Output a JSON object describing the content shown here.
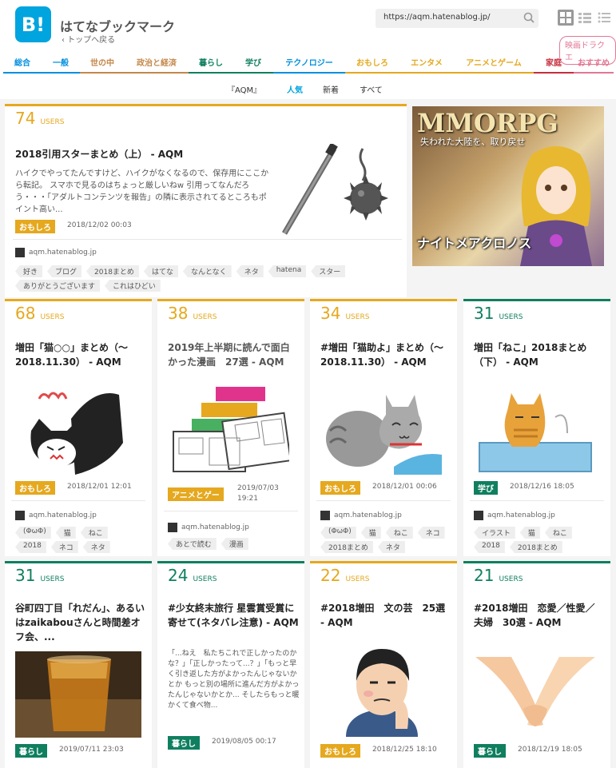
{
  "header": {
    "logo": "B!",
    "title": "はてなブックマーク",
    "back_link": "‹ トップへ戻る",
    "search_value": "https://aqm.hatenablog.jp/",
    "ad_badge": "映画ドラクエ"
  },
  "categories": [
    {
      "label": "総合",
      "color": "#008fde"
    },
    {
      "label": "一般",
      "color": "#008fde"
    },
    {
      "label": "世の中",
      "color": "#c4884a"
    },
    {
      "label": "政治と経済",
      "color": "#c4884a"
    },
    {
      "label": "暮らし",
      "color": "#0f7f5f"
    },
    {
      "label": "学び",
      "color": "#0f7f5f"
    },
    {
      "label": "テクノロジー",
      "color": "#008fde"
    },
    {
      "label": "おもしろ",
      "color": "#e5a81e"
    },
    {
      "label": "エンタメ",
      "color": "#e5a81e"
    },
    {
      "label": "アニメとゲーム",
      "color": "#e5a81e"
    },
    {
      "label": "家庭",
      "color": "#c72d3c"
    },
    {
      "label": "おすすめ",
      "color": "#e27795"
    }
  ],
  "subtabs": {
    "query": "『AQM』",
    "popular": "人気",
    "new": "新着",
    "all": "すべて"
  },
  "ad": {
    "title": "MMORPG",
    "subtitle": "失われた大陸を、取り戻せ",
    "name": "ナイトメアクロノス"
  },
  "cards": [
    {
      "users": "74",
      "users_label": "USERS",
      "title": "2018引用スターまとめ（上） - AQM",
      "desc": "ハイクでやってたんですけど、ハイクがなくなるので、保存用にここから転記。 スマホで見るのはちょっと厳しいねw 引用ってなんだろう・・・「アダルトコンテンツを報告」の隣に表示されてるところもポイント高い...",
      "tag": "おもしろ",
      "date": "2018/12/02 00:03",
      "domain": "aqm.hatenablog.jp",
      "keywords": [
        "好き",
        "ブログ",
        "2018まとめ",
        "はてな",
        "なんとなく",
        "ネタ",
        "hatena",
        "スター",
        "ありがとうございます",
        "これはひどい"
      ]
    },
    {
      "users": "68",
      "users_label": "USERS",
      "title": "増田「猫○○」まとめ（～2018.11.30） - AQM",
      "tag": "おもしろ",
      "date": "2018/12/01 12:01",
      "domain": "aqm.hatenablog.jp",
      "keywords": [
        "(ΦωΦ)",
        "猫",
        "ねこ",
        "2018",
        "ネコ",
        "ネタ"
      ]
    },
    {
      "users": "38",
      "users_label": "USERS",
      "title": "2019年上半期に読んで面白かった漫画　27選 - AQM",
      "tag": "アニメとゲー",
      "date": "2019/07/03 19:21",
      "domain": "aqm.hatenablog.jp",
      "keywords": [
        "あとで読む",
        "漫画"
      ]
    },
    {
      "users": "34",
      "users_label": "USERS",
      "title": "#増田「猫助よ」まとめ（～2018.11.30） - AQM",
      "tag": "おもしろ",
      "date": "2018/12/01 00:06",
      "domain": "aqm.hatenablog.jp",
      "keywords": [
        "(ΦωΦ)",
        "猫",
        "ねこ",
        "ネコ",
        "2018まとめ",
        "ネタ"
      ]
    },
    {
      "users": "31",
      "users_label": "USERS",
      "title": "増田「ねこ」2018まとめ（下） - AQM",
      "tag": "学び",
      "date": "2018/12/16 18:05",
      "domain": "aqm.hatenablog.jp",
      "keywords": [
        "イラスト",
        "猫",
        "ねこ",
        "2018",
        "2018まとめ"
      ]
    },
    {
      "users": "31",
      "users_label": "USERS",
      "title": "谷町四丁目「れだん」、あるいはzaikabouさんと時間差オフ会、...",
      "tag": "暮らし",
      "date": "2019/07/11 23:03"
    },
    {
      "users": "24",
      "users_label": "USERS",
      "title": "#少女終末旅行 星雲賞受賞に寄せて(ネタバレ注意) - AQM",
      "desc": "「...ねえ　私たちこれで正しかったのかな？」「正しかったって...？」「もっと早く引き返した方がよかったんじゃないかとか もっと別の場所に進んだ方がよかったんじゃないかとか... そしたらもっと暖かくて食べ物...",
      "tag": "暮らし",
      "date": "2019/08/05 00:17"
    },
    {
      "users": "22",
      "users_label": "USERS",
      "title": "#2018増田　文の芸　25選 - AQM",
      "tag": "おもしろ",
      "date": "2018/12/25 18:10"
    },
    {
      "users": "21",
      "users_label": "USERS",
      "title": "#2018増田　恋愛／性愛／夫婦　30選 - AQM",
      "tag": "暮らし",
      "date": "2018/12/19 18:05"
    }
  ],
  "colors": {
    "accent": "#00a4de",
    "omoshiro": "#e5a81e",
    "kurashi": "#0f7f5f",
    "manabi": "#0f7f5f",
    "anime": "#e5a81e"
  }
}
